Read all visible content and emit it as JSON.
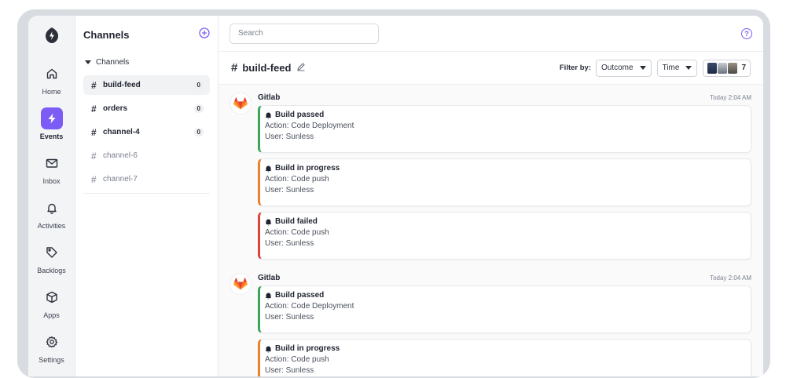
{
  "nav": [
    {
      "label": "Home",
      "icon": "home-icon"
    },
    {
      "label": "Events",
      "icon": "bolt-icon",
      "active": true
    },
    {
      "label": "Inbox",
      "icon": "mail-icon"
    },
    {
      "label": "Activities",
      "icon": "bell-icon"
    },
    {
      "label": "Backlogs",
      "icon": "tag-icon"
    },
    {
      "label": "Apps",
      "icon": "cube-icon"
    },
    {
      "label": "Settings",
      "icon": "gear-icon"
    }
  ],
  "channels_panel": {
    "title": "Channels",
    "group_label": "Channels",
    "items": [
      {
        "hash": "#",
        "name": "build-feed",
        "count": "0"
      },
      {
        "hash": "#",
        "name": "orders",
        "count": "0"
      },
      {
        "hash": "#",
        "name": "channel-4",
        "count": "0"
      },
      {
        "hash": "#",
        "name": "channel-6"
      },
      {
        "hash": "#",
        "name": "channel-7"
      }
    ]
  },
  "search": {
    "placeholder": "Search"
  },
  "help_icon_glyph": "?",
  "channel_header": {
    "hash": "#",
    "title": "build-feed",
    "filter_label": "Filter by:",
    "outcome_value": "Outcome",
    "time_value": "Time",
    "member_count": "7"
  },
  "events": [
    {
      "source": "Gitlab",
      "timestamp": "Today 2:04 AM",
      "cards": [
        {
          "title": "Build passed",
          "action": "Action: Code Deployment",
          "user": "User: Sunless",
          "status": "green"
        },
        {
          "title": "Build in progress",
          "action": "Action: Code push",
          "user": "User: Sunless",
          "status": "orange"
        },
        {
          "title": "Build failed",
          "action": "Action: Code push",
          "user": "User: Sunless",
          "status": "red"
        }
      ]
    },
    {
      "source": "Gitlab",
      "timestamp": "Today 2:04 AM",
      "cards": [
        {
          "title": "Build passed",
          "action": "Action: Code Deployment",
          "user": "User: Sunless",
          "status": "green"
        },
        {
          "title": "Build in progress",
          "action": "Action: Code push",
          "user": "User: Sunless",
          "status": "orange"
        }
      ]
    }
  ],
  "colors": {
    "accent": "#7c5cf5",
    "green": "#3ea55a",
    "orange": "#e8822f",
    "red": "#d9473b"
  }
}
